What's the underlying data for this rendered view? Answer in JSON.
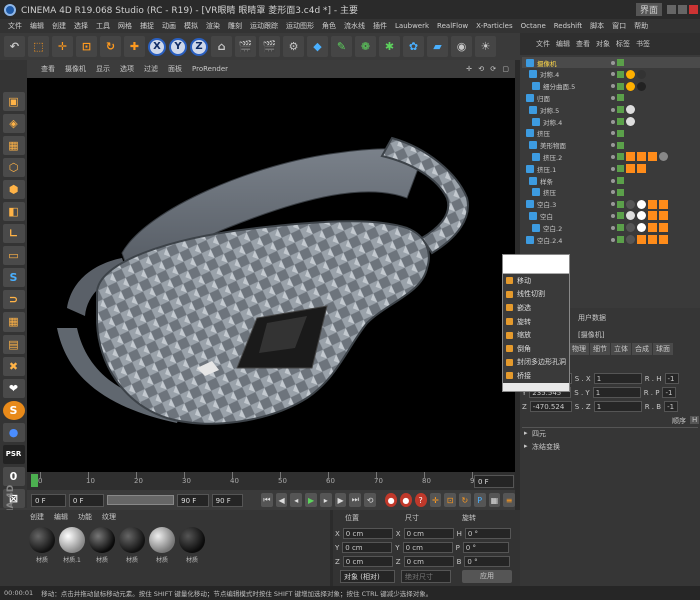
{
  "window": {
    "title": "CINEMA 4D R19.068 Studio (RC - R19) - [VR眼睛 眼睛罩 菱形面3.c4d *] - 主要",
    "layout_label": "界面"
  },
  "menu": [
    "文件",
    "编辑",
    "创建",
    "选择",
    "工具",
    "网格",
    "捕捉",
    "动画",
    "模拟",
    "渲染",
    "雕刻",
    "运动跟踪",
    "运动图形",
    "角色",
    "流水线",
    "插件",
    "Laubwerk",
    "RealFlow",
    "X-Particles",
    "Octane",
    "Redshift",
    "脚本",
    "窗口",
    "帮助"
  ],
  "viewport": {
    "menu": [
      "查看",
      "摄像机",
      "显示",
      "选项",
      "过滤",
      "面板",
      "ProRender"
    ]
  },
  "timeline": {
    "ticks": [
      "0",
      "10",
      "20",
      "30",
      "40",
      "50",
      "60",
      "70",
      "80",
      "90"
    ],
    "end_field": "0 F"
  },
  "playbar": {
    "start": "0 F",
    "current": "0 F",
    "end": "90 F",
    "end2": "90 F"
  },
  "materials": {
    "menu": [
      "创建",
      "编辑",
      "功能",
      "纹理"
    ],
    "items": [
      {
        "name": "材质"
      },
      {
        "name": "材质.1"
      },
      {
        "name": "材质"
      },
      {
        "name": "材质"
      },
      {
        "name": "材质"
      },
      {
        "name": "材质"
      }
    ]
  },
  "coordinates": {
    "headers": [
      "位置",
      "尺寸",
      "旋转"
    ],
    "rows": [
      {
        "a": "X",
        "pos": "0 cm",
        "b": "X",
        "size": "0 cm",
        "c": "H",
        "rot": "0 °"
      },
      {
        "a": "Y",
        "pos": "0 cm",
        "b": "Y",
        "size": "0 cm",
        "c": "P",
        "rot": "0 °"
      },
      {
        "a": "Z",
        "pos": "0 cm",
        "b": "Z",
        "size": "0 cm",
        "c": "B",
        "rot": "0 °"
      }
    ],
    "mode": "对象 (相对)",
    "size_mode": "绝对尺寸",
    "apply": "应用"
  },
  "status": {
    "time": "00:00:01",
    "text": "移动：点击并拖动鼠标移动元素。按住 SHIFT 键量化移动；节点编辑模式时按住 SHIFT 键增加选择对象；按住 CTRL 键减少选择对象。"
  },
  "object_manager": {
    "menu": [
      "文件",
      "编辑",
      "查看",
      "对象",
      "标签",
      "书签"
    ],
    "objects": [
      {
        "name": "摄像机",
        "color": "#ffd84a"
      },
      {
        "name": "对称.4",
        "color": "#c8c8c8"
      },
      {
        "name": "细分曲面.5",
        "color": "#c8c8c8"
      },
      {
        "name": "归面",
        "color": "#c8c8c8"
      },
      {
        "name": "对称.5",
        "color": "#c8c8c8"
      },
      {
        "name": "对称.4",
        "color": "#c8c8c8"
      },
      {
        "name": "挤压",
        "color": "#c8c8c8"
      },
      {
        "name": "美形物面",
        "color": "#c8c8c8"
      },
      {
        "name": "挤压.2",
        "color": "#c8c8c8"
      },
      {
        "name": "挤压.1",
        "color": "#c8c8c8"
      },
      {
        "name": "样条",
        "color": "#c8c8c8"
      },
      {
        "name": "挤压",
        "color": "#c8c8c8"
      },
      {
        "name": "空白.3",
        "color": "#c8c8c8"
      },
      {
        "name": "空白",
        "color": "#c8c8c8"
      },
      {
        "name": "空白.2",
        "color": "#c8c8c8"
      },
      {
        "name": "空白.2.4",
        "color": "#c8c8c8"
      }
    ]
  },
  "attributes": {
    "header": "用户数据",
    "object_label": "[摄像机]",
    "tabs": [
      "对象",
      "物理",
      "细节",
      "立体",
      "合成",
      "球面"
    ],
    "rows": [
      {
        "axis": "X",
        "val": "-287.8",
        "c": "S . X",
        "v2": "1",
        "c2": "R . H",
        "v3": "-1"
      },
      {
        "axis": "Y",
        "val": "235.545",
        "c": "S . Y",
        "v2": "1",
        "c2": "R . P",
        "v3": "-1"
      },
      {
        "axis": "Z",
        "val": "-470.524",
        "c": "S . Z",
        "v2": "1",
        "c2": "R . B",
        "v3": "-1"
      }
    ],
    "order_label": "顺序",
    "order_value": "H",
    "sections": [
      "四元",
      "冻结变换"
    ]
  },
  "context_menu": {
    "items": [
      {
        "label": "移动"
      },
      {
        "label": "线性切割"
      },
      {
        "label": "嵌选"
      },
      {
        "label": "旋转"
      },
      {
        "label": "缩放"
      },
      {
        "label": "倒角"
      },
      {
        "label": "封闭多边形孔洞"
      },
      {
        "label": "桥接"
      }
    ]
  },
  "colors": {
    "accent": "#ff9a1f",
    "selected": "#ffd84a",
    "bg": "#2b2b2b"
  }
}
